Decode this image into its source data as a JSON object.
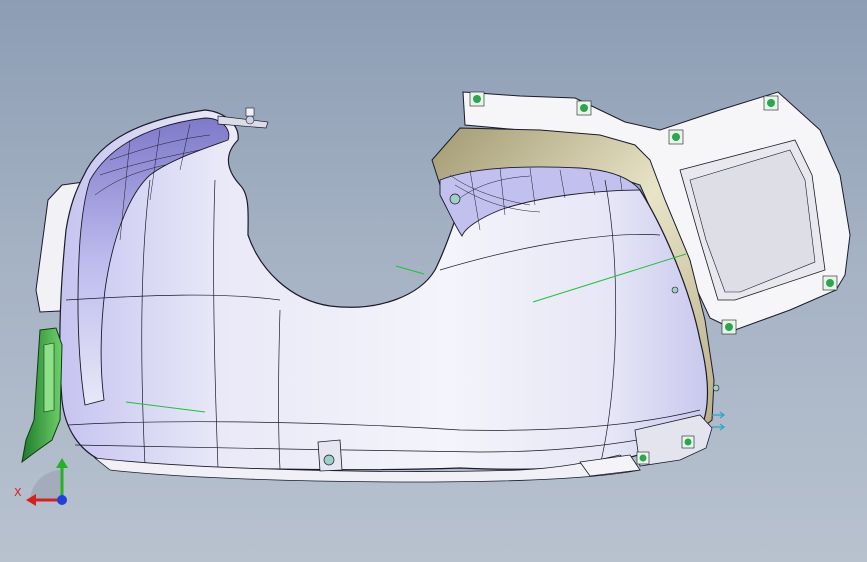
{
  "viewport": {
    "background_top": "#8d9db4",
    "background_bottom": "#b8c2cf"
  },
  "model": {
    "body_color": "#eceef8",
    "shade_color": "#b9b7ec",
    "edge_color": "#1a1a2a",
    "fastener_color": "#2ea44f",
    "axis_line_color": "#22c03a"
  },
  "triad": {
    "x_label": "X",
    "x_color": "#d42020",
    "y_color": "#28b028",
    "z_color": "#2040d8"
  }
}
